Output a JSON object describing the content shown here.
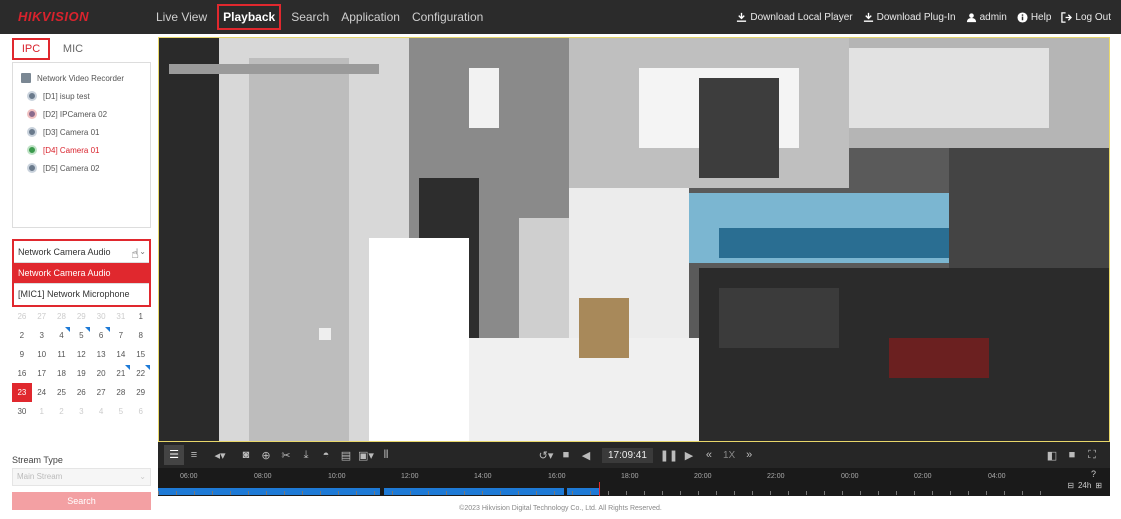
{
  "brand": {
    "logo": "HIKVISION",
    "accent": "#e0282e"
  },
  "nav": {
    "items": [
      {
        "label": "Live View"
      },
      {
        "label": "Playback"
      },
      {
        "label": "Search"
      },
      {
        "label": "Application"
      },
      {
        "label": "Configuration"
      }
    ],
    "active": "Playback"
  },
  "topright": {
    "download_player": "Download Local Player",
    "download_plugin": "Download Plug-In",
    "user": "admin",
    "help": "Help",
    "logout": "Log Out"
  },
  "left": {
    "tabs": [
      {
        "label": "IPC"
      },
      {
        "label": "MIC"
      }
    ],
    "tree": {
      "root": "Network Video Recorder",
      "cameras": [
        {
          "label": "[D1] isup test"
        },
        {
          "label": "[D2] IPCamera 02"
        },
        {
          "label": "[D3] Camera 01"
        },
        {
          "label": "[D4] Camera 01"
        },
        {
          "label": "[D5] Camera 02"
        }
      ]
    },
    "audio_select": {
      "value": "Network Camera Audio",
      "options": [
        "Network Camera Audio",
        "[MIC1] Network Microphone"
      ]
    },
    "calendar": {
      "rows": [
        [
          "26",
          "27",
          "28",
          "29",
          "30",
          "31",
          "1"
        ],
        [
          "2",
          "3",
          "4",
          "5",
          "6",
          "7",
          "8"
        ],
        [
          "9",
          "10",
          "11",
          "12",
          "13",
          "14",
          "15"
        ],
        [
          "16",
          "17",
          "18",
          "19",
          "20",
          "21",
          "22"
        ],
        [
          "23",
          "24",
          "25",
          "26",
          "27",
          "28",
          "29"
        ],
        [
          "30",
          "1",
          "2",
          "3",
          "4",
          "5",
          "6"
        ]
      ],
      "today": "23"
    },
    "stream_type_label": "Stream Type",
    "stream_type_value": "Main Stream",
    "search_label": "Search"
  },
  "player": {
    "time": "17:09:41",
    "speed": "1X"
  },
  "timeline": {
    "labels": [
      "06:00",
      "08:00",
      "10:00",
      "12:00",
      "14:00",
      "16:00",
      "18:00",
      "20:00",
      "22:00",
      "00:00",
      "02:00",
      "04:00"
    ],
    "zoom": "24h"
  },
  "footer": "©2023 Hikvision Digital Technology Co., Ltd. All Rights Reserved."
}
